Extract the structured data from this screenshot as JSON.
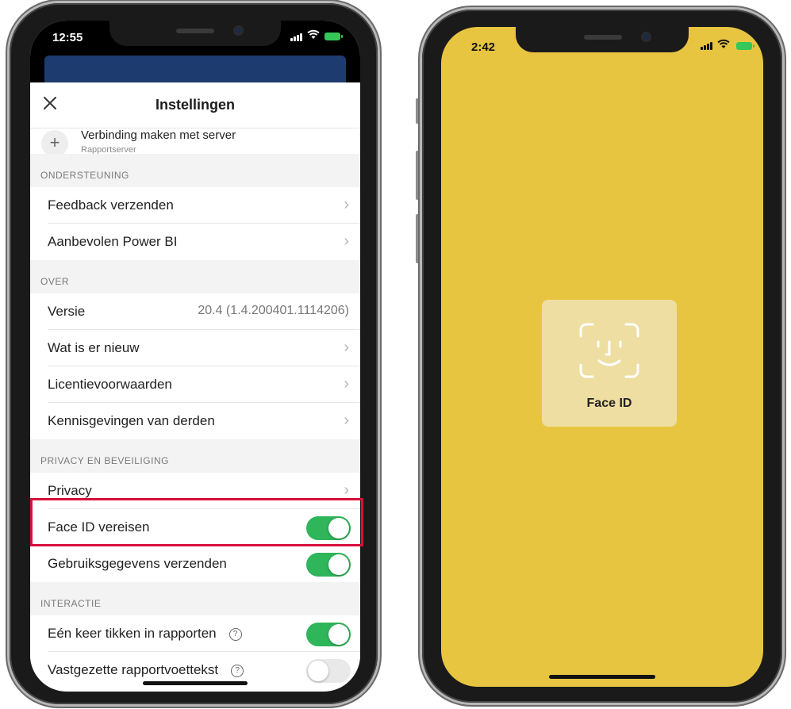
{
  "left_phone": {
    "status": {
      "time": "12:55"
    },
    "header": {
      "title": "Instellingen",
      "close_icon": "close-icon"
    },
    "connect": {
      "label": "Verbinding maken met server",
      "sub": "Rapportserver"
    },
    "sections": {
      "support": "ONDERSTEUNING",
      "about": "OVER",
      "privacy": "PRIVACY EN BEVEILIGING",
      "interaction": "INTERACTIE"
    },
    "rows": {
      "feedback": "Feedback verzenden",
      "recommended": "Aanbevolen Power BI",
      "version_label": "Versie",
      "version_value": "20.4 (1.4.200401.1114206)",
      "whats_new": "Wat is er nieuw",
      "license": "Licentievoorwaarden",
      "third_party": "Kennisgevingen van derden",
      "privacy": "Privacy",
      "face_id": "Face ID vereisen",
      "usage": "Gebruiksgegevens verzenden",
      "single_tap": "Eén keer tikken in rapporten",
      "footer": "Vastgezette rapportvoettekst"
    },
    "toggles": {
      "face_id": true,
      "usage": true,
      "single_tap": true,
      "footer": false
    },
    "colors": {
      "toggle_on": "#2fb55a",
      "toggle_off": "#e9e9e9",
      "highlight": "#d8103b"
    }
  },
  "right_phone": {
    "status": {
      "time": "2:42"
    },
    "face_id_label": "Face ID",
    "colors": {
      "background": "#e8c541"
    }
  }
}
